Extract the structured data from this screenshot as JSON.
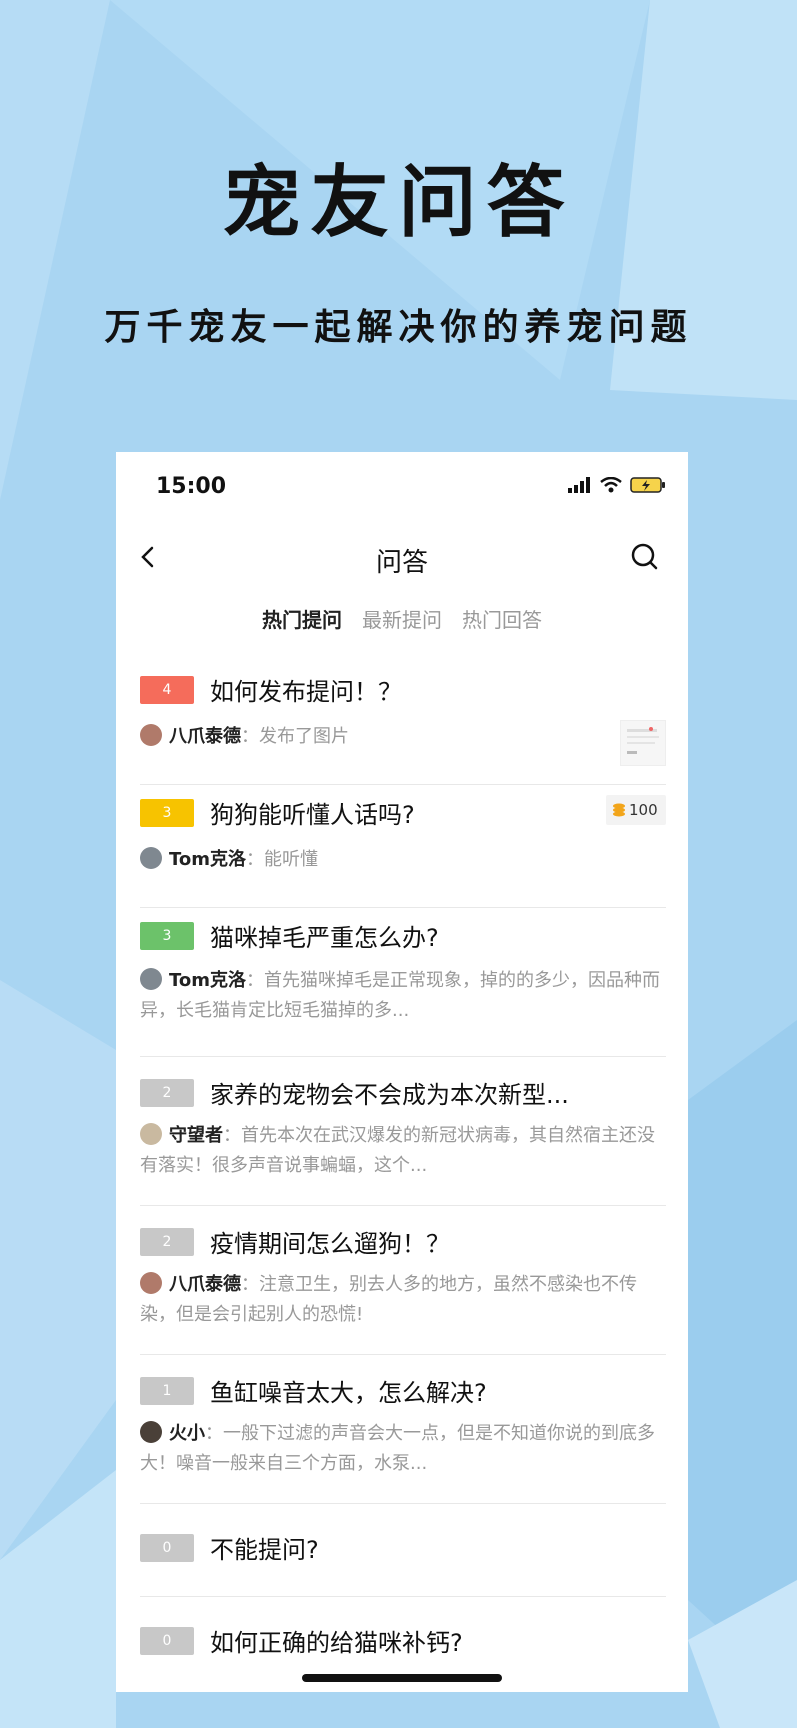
{
  "promo": {
    "headline": "宠友问答",
    "subline": "万千宠友一起解决你的养宠问题"
  },
  "status_bar": {
    "time": "15:00"
  },
  "nav": {
    "title": "问答"
  },
  "tabs": [
    "热门提问",
    "最新提问",
    "热门回答"
  ],
  "icons": {
    "back": "chevron-left-icon",
    "search": "search-icon",
    "signal": "signal-icon",
    "wifi": "wifi-icon",
    "battery": "battery-icon",
    "coin": "coin-stack-icon"
  },
  "colors": {
    "background": "#a8d4f1",
    "badge_red": "#f56c5b",
    "badge_yellow": "#f7c300",
    "badge_green": "#6cc26a",
    "badge_gray": "#c8c8c8"
  },
  "questions": [
    {
      "count": "4",
      "title": "如何发布提问！？",
      "author": "八爪泰德",
      "sep": "：",
      "answer": "发布了图片",
      "badge_color": "#f56c5b"
    },
    {
      "count": "3",
      "title": "狗狗能听懂人话吗?",
      "author": "Tom克洛",
      "sep": "：",
      "answer": "能听懂",
      "reward": "100",
      "badge_color": "#f7c300"
    },
    {
      "count": "3",
      "title": "猫咪掉毛严重怎么办?",
      "author": "Tom克洛",
      "sep": "：",
      "answer": "首先猫咪掉毛是正常现象，掉的的多少，因品种而异，长毛猫肯定比短毛猫掉的多...",
      "badge_color": "#6cc26a"
    },
    {
      "count": "2",
      "title": "家养的宠物会不会成为本次新型...",
      "author": "守望者",
      "sep": "：",
      "answer": "首先本次在武汉爆发的新冠状病毒，其自然宿主还没有落实！很多声音说事蝙蝠，这个...",
      "badge_color": "#c8c8c8"
    },
    {
      "count": "2",
      "title": "疫情期间怎么遛狗！？",
      "author": "八爪泰德",
      "sep": "：",
      "answer": "注意卫生，别去人多的地方，虽然不感染也不传染，但是会引起别人的恐慌!",
      "badge_color": "#c8c8c8"
    },
    {
      "count": "1",
      "title": "鱼缸噪音太大，怎么解决?",
      "author": "火小",
      "sep": "：",
      "answer": "一般下过滤的声音会大一点，但是不知道你说的到底多大！噪音一般来自三个方面，水泵...",
      "badge_color": "#c8c8c8"
    },
    {
      "count": "0",
      "title": "不能提问?",
      "badge_color": "#c8c8c8"
    },
    {
      "count": "0",
      "title": "如何正确的给猫咪补钙?",
      "badge_color": "#c8c8c8"
    }
  ]
}
